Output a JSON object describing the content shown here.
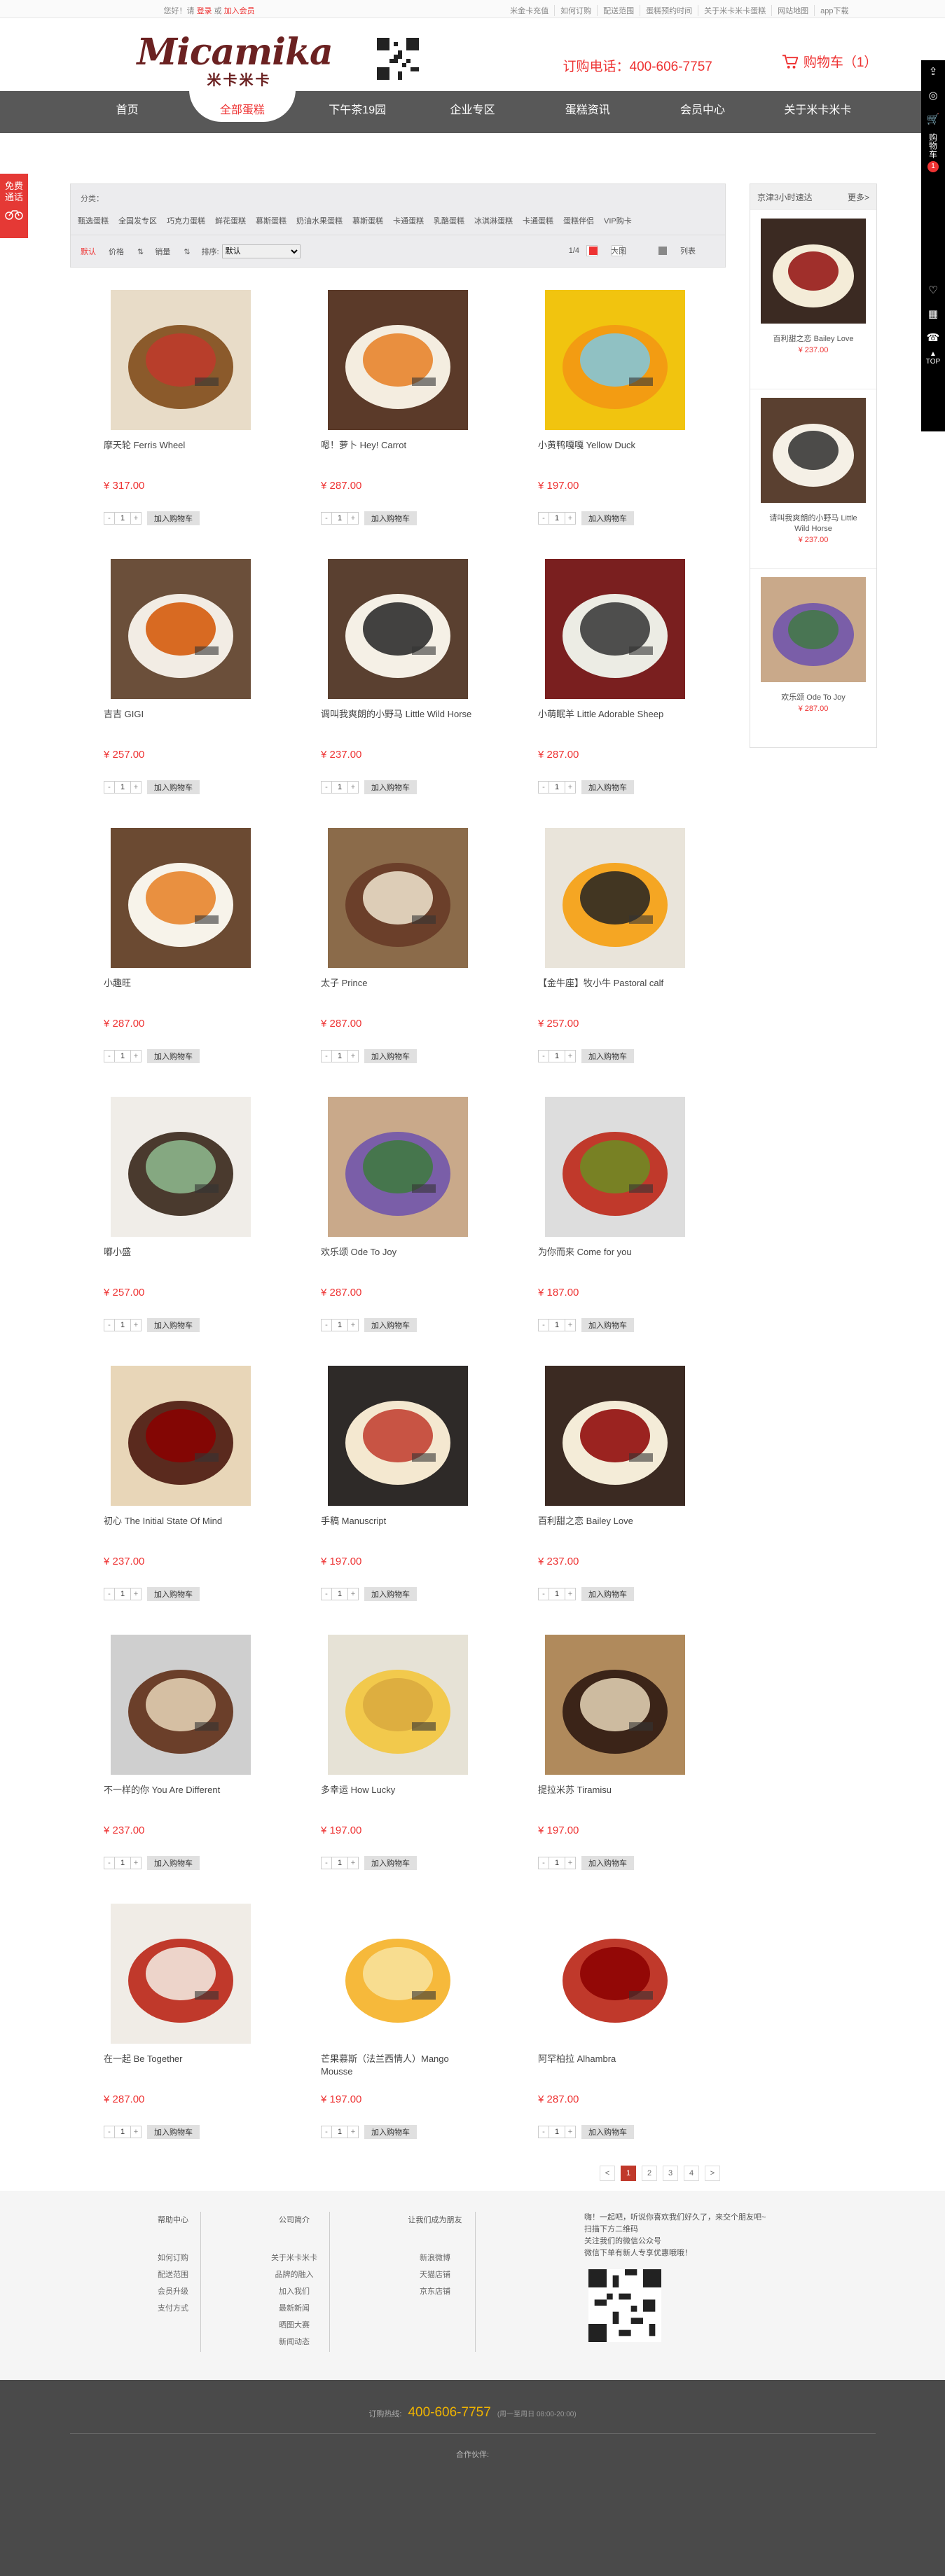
{
  "topbar": {
    "welcome_prefix": "您好！请",
    "login": "登录",
    "or": "或",
    "register": "加入会员",
    "links": [
      "米金卡充值",
      "如何订购",
      "配送范围",
      "蛋糕预约时间",
      "关于米卡米卡蛋糕",
      "网站地图",
      "app下载"
    ]
  },
  "header": {
    "logo_word": "Micamika",
    "logo_chinese": "米卡米卡",
    "phone": "订购电话：400-606-7757",
    "cart": "购物车（1）"
  },
  "nav": [
    "首页",
    "全部蛋糕",
    "下午茶19园",
    "企业专区",
    "蛋糕资讯",
    "会员中心",
    "关于米卡米卡"
  ],
  "free_call": "免费通话",
  "right_bar": {
    "cart_label": "购物车",
    "badge": "1",
    "top": "TOP"
  },
  "filter": {
    "category_label": "分类：",
    "categories": [
      "甄选蛋糕",
      "全国发专区",
      "巧克力蛋糕",
      "鲜花蛋糕",
      "慕斯蛋糕",
      "奶油水果蛋糕",
      "慕斯蛋糕",
      "卡通蛋糕",
      "乳酪蛋糕",
      "冰淇淋蛋糕",
      "卡通蛋糕",
      "蛋糕伴侣",
      "VIP购卡"
    ],
    "sort_default": "默认",
    "sort_price": "价格",
    "sort_sales": "销量",
    "sort_label": "排序:",
    "sort_select": "默认",
    "page_info": "1/4",
    "view_large": "大图",
    "view_list": "列表"
  },
  "products": [
    {
      "name": "摩天轮 Ferris Wheel",
      "price": "¥ 317.00",
      "qty": "1"
    },
    {
      "name": "嗯！萝卜 Hey! Carrot",
      "price": "¥ 287.00",
      "qty": "1"
    },
    {
      "name": "小黄鸭嘎嘎 Yellow Duck",
      "price": "¥ 197.00",
      "qty": "1"
    },
    {
      "name": "吉吉 GIGI",
      "price": "¥ 257.00",
      "qty": "1"
    },
    {
      "name": "调叫我爽朗的小野马 Little Wild Horse",
      "price": "¥ 237.00",
      "qty": "1"
    },
    {
      "name": "小萌眠羊 Little Adorable Sheep",
      "price": "¥ 287.00",
      "qty": "1"
    },
    {
      "name": "小趣旺",
      "price": "¥ 287.00",
      "qty": "1"
    },
    {
      "name": "太子 Prince",
      "price": "¥ 287.00",
      "qty": "1"
    },
    {
      "name": "【金牛座】牧小牛 Pastoral calf",
      "price": "¥ 257.00",
      "qty": "1"
    },
    {
      "name": "嘟小盛",
      "price": "¥ 257.00",
      "qty": "1"
    },
    {
      "name": "欢乐颂 Ode To Joy",
      "price": "¥ 287.00",
      "qty": "1"
    },
    {
      "name": "为你而来 Come for you",
      "price": "¥ 187.00",
      "qty": "1"
    },
    {
      "name": "初心 The Initial State Of Mind",
      "price": "¥ 237.00",
      "qty": "1"
    },
    {
      "name": "手稿 Manuscript",
      "price": "¥ 197.00",
      "qty": "1"
    },
    {
      "name": "百利甜之恋 Bailey Love",
      "price": "¥ 237.00",
      "qty": "1"
    },
    {
      "name": "不一样的你 You Are Different",
      "price": "¥ 237.00",
      "qty": "1"
    },
    {
      "name": "多幸运 How Lucky",
      "price": "¥ 197.00",
      "qty": "1"
    },
    {
      "name": "提拉米苏 Tiramisu",
      "price": "¥ 197.00",
      "qty": "1"
    },
    {
      "name": "在一起 Be Together",
      "price": "¥ 287.00",
      "qty": "1"
    },
    {
      "name": "芒果慕斯（法兰西情人）Mango Mousse",
      "price": "¥ 197.00",
      "qty": "1"
    },
    {
      "name": "阿罕柏拉 Alhambra",
      "price": "¥ 287.00",
      "qty": "1"
    }
  ],
  "add_to_cart": "加入购物车",
  "pagination": [
    "<",
    "1",
    "2",
    "3",
    "4",
    ">"
  ],
  "recommend": {
    "title": "京津3小时速达",
    "more": "更多>",
    "items": [
      {
        "name": "百利甜之恋 Bailey Love",
        "price": "¥ 237.00"
      },
      {
        "name": "请叫我爽朗的小野马 Little Wild Horse",
        "price": "¥ 237.00"
      },
      {
        "name": "欢乐颂 Ode To Joy",
        "price": "¥ 287.00"
      }
    ]
  },
  "footer": {
    "help": {
      "title": "帮助中心",
      "items": [
        "如何订购",
        "配送范围",
        "会员升级",
        "支付方式"
      ]
    },
    "company": {
      "title": "公司简介",
      "items": [
        "关于米卡米卡",
        "品牌的融入",
        "加入我们",
        "最新新闻",
        "晒图大赛",
        "新闻动态"
      ]
    },
    "find": {
      "title": "让我们成为朋友",
      "items": [
        "新浪微博",
        "天猫店铺",
        "京东店铺"
      ]
    },
    "qr_text": [
      "嗨！一起吧，听说你喜欢我们好久了，来交个朋友吧~",
      "扫描下方二维码",
      "关注我们的微信公众号",
      "微信下单有新人专享优惠哦哦！"
    ],
    "tel_label": "订购热线:",
    "tel": "400-606-7757",
    "tel_hours": "(周一至周日 08:00-20:00)",
    "partners_label": "合作伙伴:"
  }
}
